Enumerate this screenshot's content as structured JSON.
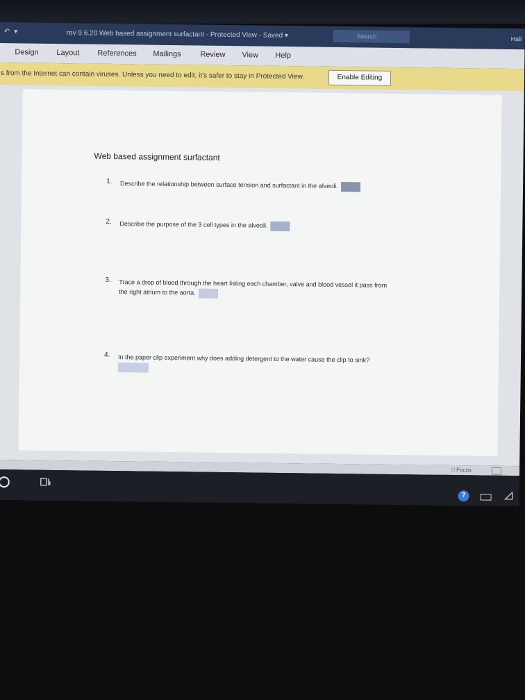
{
  "titlebar": {
    "quick_access": "▾",
    "title": "rev 9.6.20 Web based assignment surfactant  -  Protected View  -  Saved  ▾",
    "search_placeholder": "Search",
    "user_fragment": "Hall"
  },
  "ribbon": {
    "tabs": [
      "Design",
      "Layout",
      "References",
      "Mailings",
      "Review",
      "View",
      "Help"
    ]
  },
  "protected_view": {
    "message": "s from the Internet can contain viruses. Unless you need to edit, it's safer to stay in Protected View.",
    "enable_button": "Enable Editing"
  },
  "document": {
    "heading": "Web based assignment surfactant",
    "questions": [
      {
        "num": "1.",
        "text": "Describe the relationship between surface tension and surfactant in the alveoli."
      },
      {
        "num": "2.",
        "text": "Describe the purpose of the 3 cell types in the alveoli."
      },
      {
        "num": "3.",
        "text": "Trace a drop of blood through the heart listing each chamber, valve and blood vessel it pass from",
        "text2": "the right atrium to the aorta."
      },
      {
        "num": "4.",
        "text": "In the paper clip experiment why does adding detergent to the water cause the clip to sink?"
      }
    ]
  },
  "statusbar": {
    "focus_label": "Focus"
  },
  "taskbar": {
    "help_glyph": "?"
  },
  "colors": {
    "titlebar": "#2a3a5a",
    "warnbar": "#e9d98a",
    "answer_box": "#8e98b3"
  }
}
